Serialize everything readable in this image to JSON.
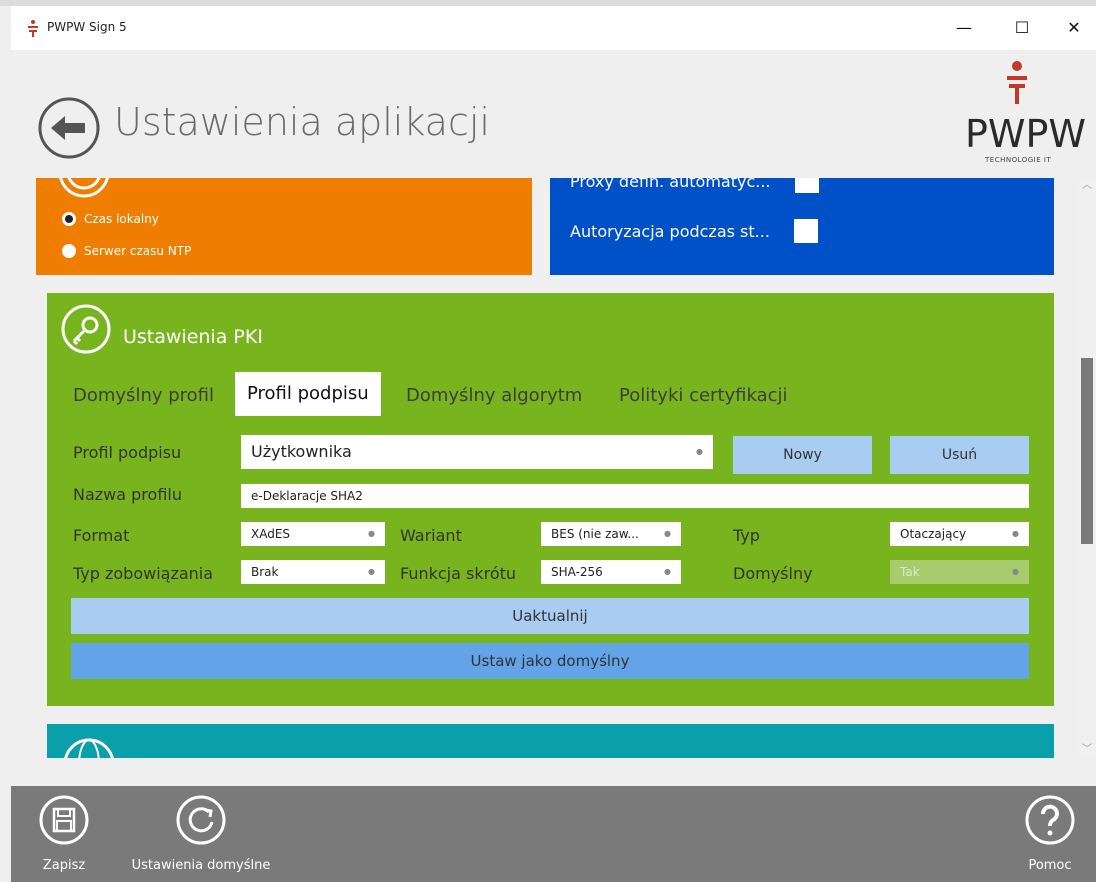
{
  "window": {
    "title": "PWPW Sign 5",
    "controls": {
      "minimize": "—",
      "maximize": "☐",
      "close": "✕"
    }
  },
  "header": {
    "title": "Ustawienia aplikacji",
    "logo_text": "PWPW",
    "logo_subtext": "TECHNOLOGIE IT"
  },
  "time_source": {
    "options": [
      {
        "label": "Czas lokalny",
        "checked": true
      },
      {
        "label": "Serwer czasu NTP",
        "checked": false
      }
    ]
  },
  "proxy": {
    "rows": [
      {
        "label": "Proxy defin. automatyc...",
        "checked": false
      },
      {
        "label": "Autoryzacja podczas st...",
        "checked": false
      }
    ]
  },
  "pki": {
    "title": "Ustawienia PKI",
    "tabs": [
      {
        "label": "Domyślny profil",
        "active": false
      },
      {
        "label": "Profil podpisu",
        "active": true
      },
      {
        "label": "Domyślny algorytm",
        "active": false
      },
      {
        "label": "Polityki certyfikacji",
        "active": false
      }
    ],
    "profile_label": "Profil podpisu",
    "profile_value": "Użytkownika",
    "new_button": "Nowy",
    "delete_button": "Usuń",
    "name_label": "Nazwa profilu",
    "name_value": "e-Deklaracje SHA2",
    "format_label": "Format",
    "format_value": "XAdES",
    "variant_label": "Wariant",
    "variant_value": "BES (nie zaw...",
    "type_label": "Typ",
    "type_value": "Otaczający",
    "commitment_label": "Typ zobowiązania",
    "commitment_value": "Brak",
    "hash_label": "Funkcja skrótu",
    "hash_value": "SHA-256",
    "default_label": "Domyślny",
    "default_value": "Tak",
    "update_button": "Uaktualnij",
    "set_default_button": "Ustaw jako domyślny"
  },
  "bottom_bar": {
    "save_label": "Zapisz",
    "defaults_label": "Ustawienia domyślne",
    "help_label": "Pomoc"
  },
  "colors": {
    "orange": "#ef7d00",
    "blue": "#0050c8",
    "green": "#78b41e",
    "teal": "#0aa0aa",
    "bottom_bar": "#7a7a7a"
  }
}
